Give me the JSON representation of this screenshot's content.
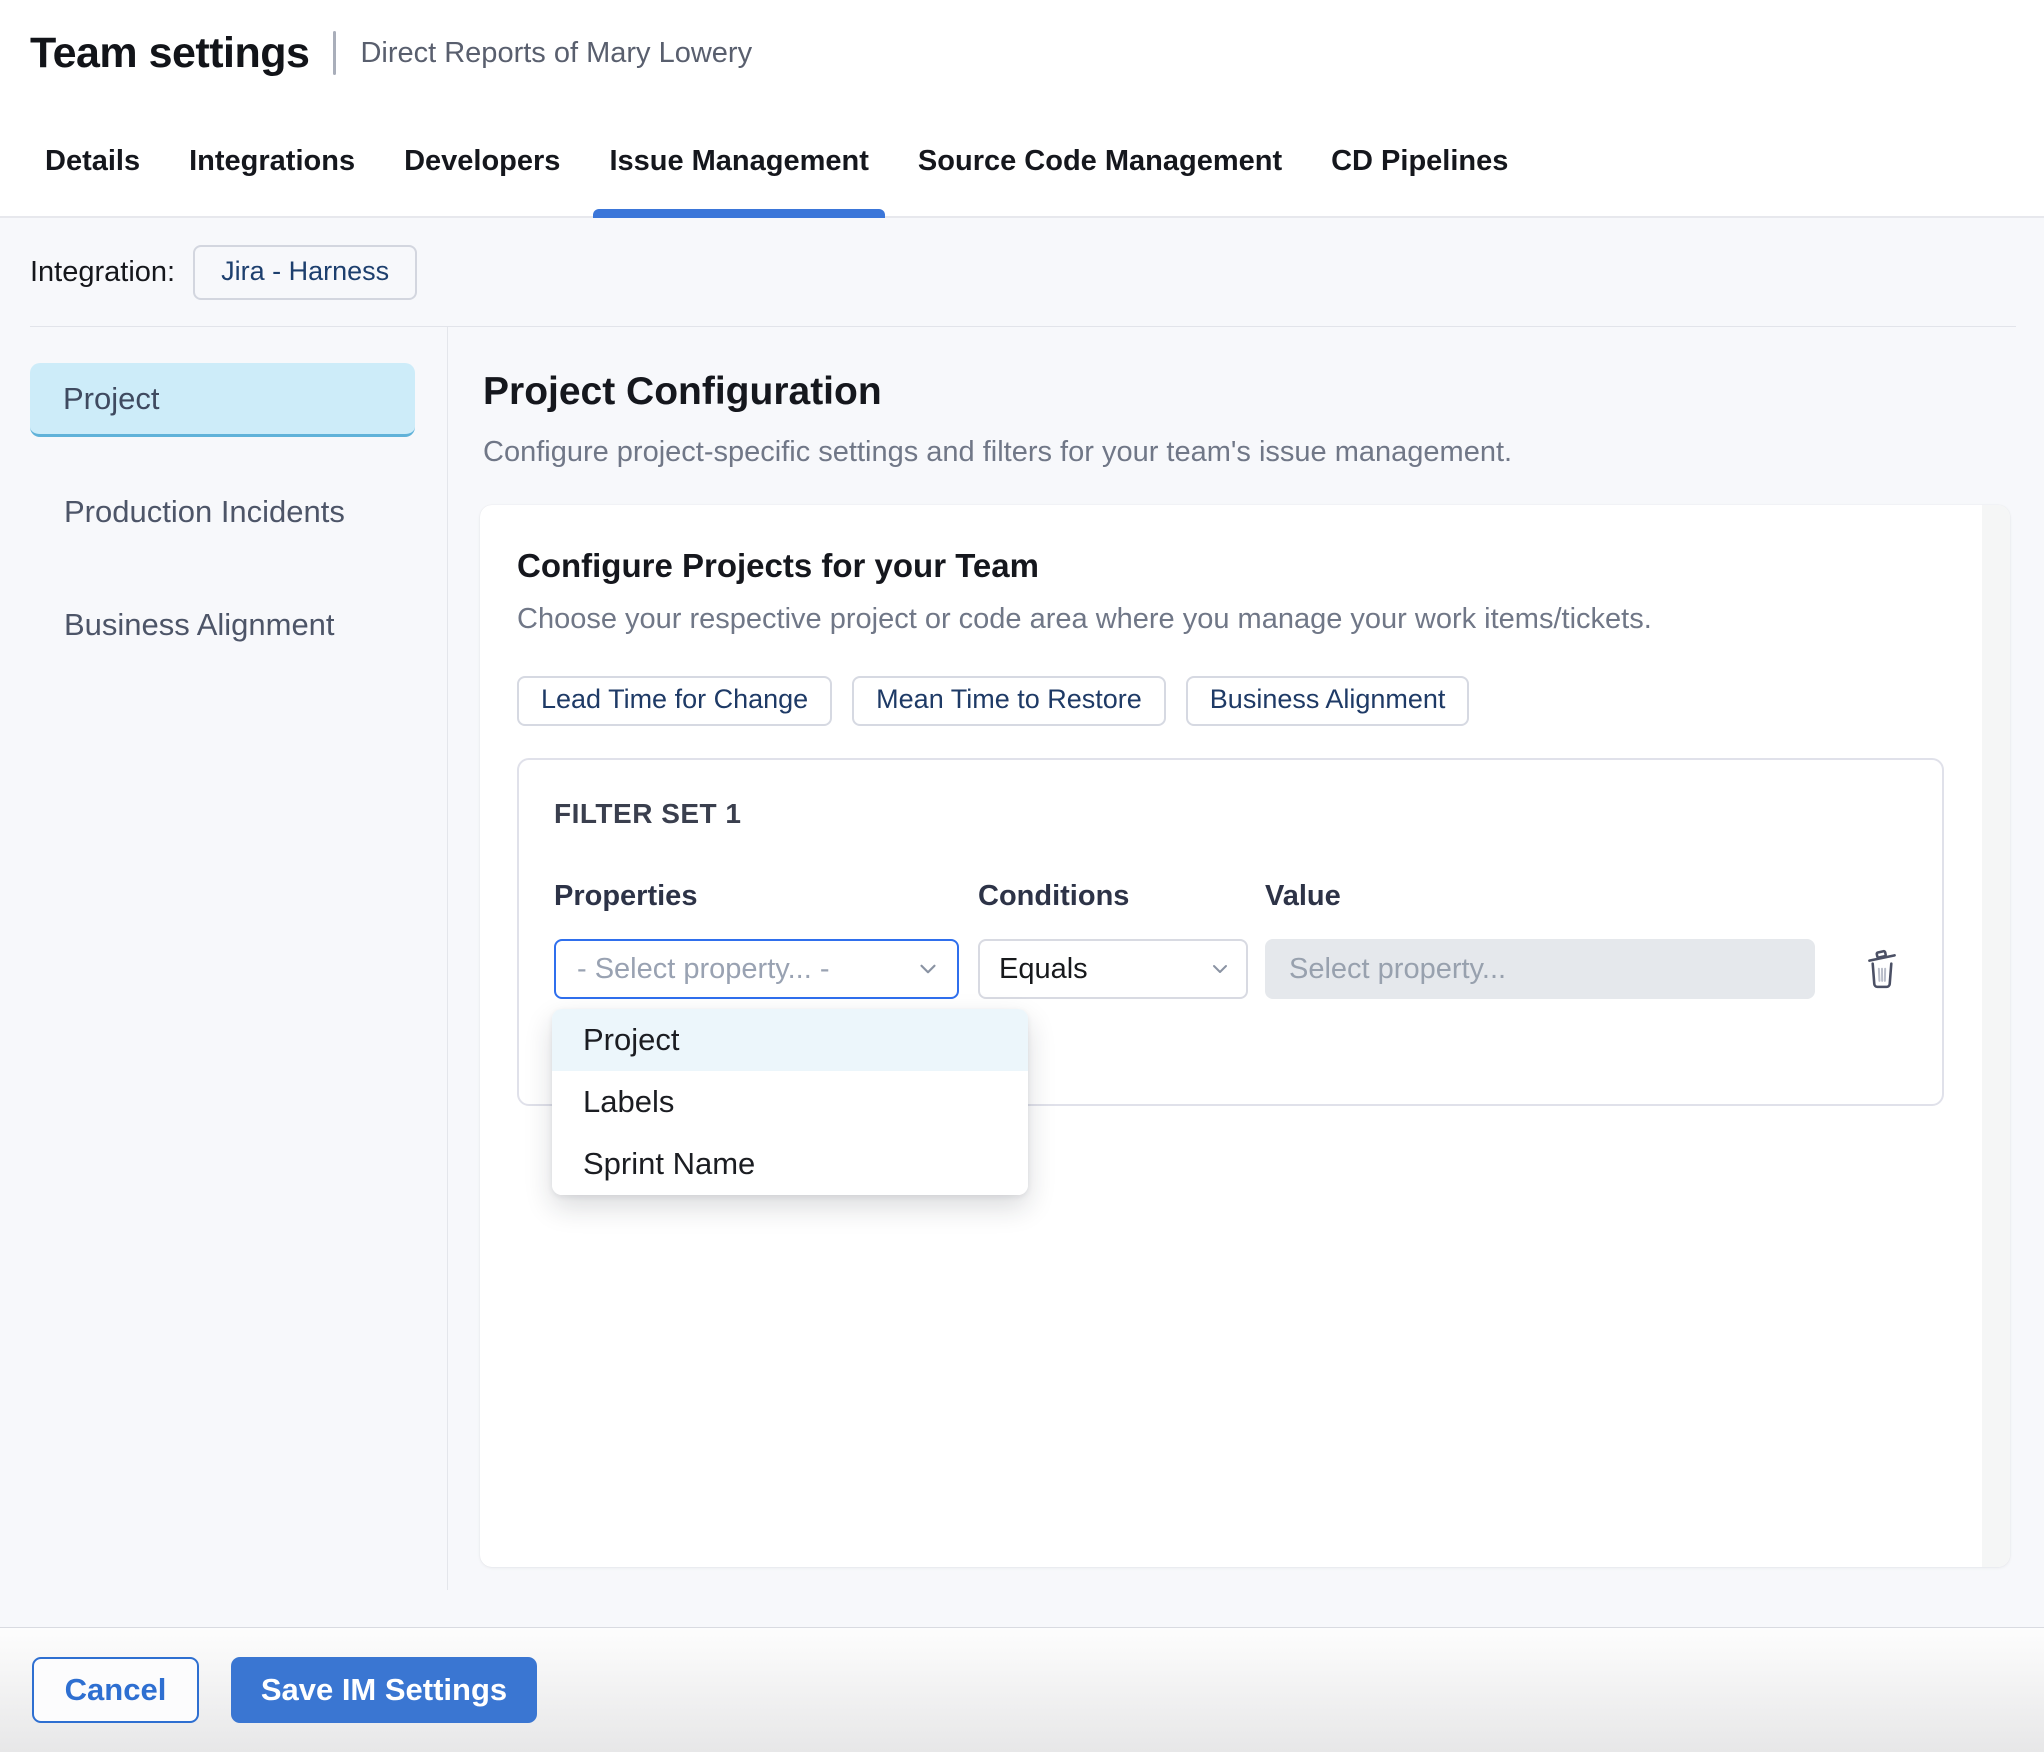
{
  "header": {
    "title": "Team settings",
    "subtitle": "Direct Reports of Mary Lowery"
  },
  "tabs": {
    "items": [
      {
        "label": "Details",
        "active": false
      },
      {
        "label": "Integrations",
        "active": false
      },
      {
        "label": "Developers",
        "active": false
      },
      {
        "label": "Issue Management",
        "active": true
      },
      {
        "label": "Source Code Management",
        "active": false
      },
      {
        "label": "CD Pipelines",
        "active": false
      }
    ]
  },
  "integration": {
    "label": "Integration:",
    "value": "Jira - Harness"
  },
  "sidebar": {
    "items": [
      {
        "label": "Project",
        "selected": true
      },
      {
        "label": "Production Incidents",
        "selected": false
      },
      {
        "label": "Business Alignment",
        "selected": false
      }
    ]
  },
  "main": {
    "title": "Project Configuration",
    "description": "Configure project-specific settings and filters for your team's issue management.",
    "card": {
      "title": "Configure Projects for your Team",
      "description": "Choose your respective project or code area where you manage your work items/tickets.",
      "chips": [
        {
          "label": "Lead Time for Change"
        },
        {
          "label": "Mean Time to Restore"
        },
        {
          "label": "Business Alignment"
        }
      ],
      "filter_set": {
        "title": "FILTER SET 1",
        "columns": {
          "properties": "Properties",
          "conditions": "Conditions",
          "value": "Value"
        },
        "property_placeholder": "- Select property... -",
        "condition_value": "Equals",
        "value_placeholder": "Select property...",
        "dropdown": {
          "options": [
            {
              "label": "Project",
              "highlighted": true
            },
            {
              "label": "Labels",
              "highlighted": false
            },
            {
              "label": "Sprint Name",
              "highlighted": false
            }
          ]
        }
      }
    }
  },
  "footer": {
    "cancel_label": "Cancel",
    "save_label": "Save IM Settings"
  },
  "icons": {
    "property_select": "chevron-down-icon",
    "condition_select": "chevron-down-icon",
    "delete_filter": "trash-icon"
  },
  "colors": {
    "primary_blue": "#3a76d2",
    "tab_underline": "#3b76d9",
    "focus_border": "#2f6fed",
    "sidebar_selected_bg": "#cdecf9",
    "sidebar_selected_border": "#60b2d9",
    "dropdown_highlight": "#ecf6fb",
    "chip_text": "#1e3a66",
    "page_background": "#f7f8fb",
    "value_input_bg": "#e5e8ec"
  }
}
